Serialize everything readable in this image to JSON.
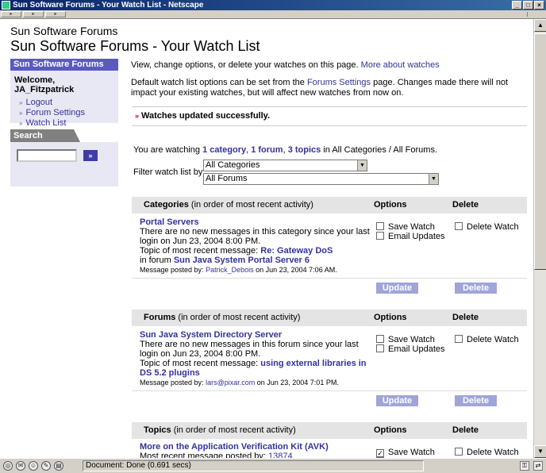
{
  "window": {
    "title": "Sun Software Forums - Your Watch List - Netscape"
  },
  "status": {
    "text": "Document: Done (0.691 secs)"
  },
  "header": {
    "site_name": "Sun Software Forums",
    "page_title": "Sun Software Forums - Your Watch List"
  },
  "sidebar": {
    "title": "Sun Software Forums",
    "welcome": "Welcome, JA_Fitzpatrick",
    "links": [
      "Logout",
      "Forum Settings",
      "Watch List"
    ],
    "search_title": "Search Forums",
    "search_button": "»"
  },
  "main": {
    "intro": "View, change options, or delete your watches on this page.",
    "intro_link": "More about watches",
    "defaults_prefix": "Default watch list options can be set from the",
    "defaults_link": "Forums Settings",
    "defaults_suffix": "page. Changes made there will not impact your existing watches, but will affect new watches from now on.",
    "success": "Watches updated successfully.",
    "watching_prefix": "You are watching",
    "watching_cat": "1 category",
    "watching_forum": "1 forum",
    "watching_topics": "3 topics",
    "watching_suffix": "in All Categories / All Forums.",
    "filter_label": "Filter watch list by:",
    "filter_category": "All Categories",
    "filter_forum": "All Forums"
  },
  "labels": {
    "options": "Options",
    "delete": "Delete",
    "save_watch": "Save Watch",
    "email_updates": "Email Updates",
    "delete_watch": "Delete Watch",
    "update_btn": "Update",
    "delete_btn": "Delete"
  },
  "categories": {
    "heading": "Categories",
    "sub": "(in order of most recent activity)",
    "item_title": "Portal Servers",
    "item_text": "There are no new messages in this category since your last login on Jun 23, 2004 8:00 PM.",
    "recent_prefix": "Topic of most recent message:",
    "recent_link": "Re: Gateway DoS",
    "forum_prefix": "in forum",
    "forum_link": "Sun Java System Portal Server 6",
    "posted_prefix": "Message posted by:",
    "posted_user": "Patrick_Debois",
    "posted_suffix": "on Jun 23, 2004 7:06 AM."
  },
  "forums": {
    "heading": "Forums",
    "sub": "(in order of most recent activity)",
    "item_title": "Sun Java System Directory Server",
    "item_text": "There are no new messages in this forum since your last login on Jun 23, 2004 8:00 PM.",
    "recent_prefix": "Topic of most recent message:",
    "recent_link": "using external libraries in DS 5.2 plugins",
    "posted_prefix": "Message posted by:",
    "posted_user": "lars@pixar.com",
    "posted_suffix": "on Jun 23, 2004 7:01 PM."
  },
  "topics": {
    "heading": "Topics",
    "sub": "(in order of most recent activity)",
    "item_title": "More on the Application Verification Kit (AVK)",
    "posted_prefix": "Most recent message posted by:",
    "posted_user": "13874"
  }
}
